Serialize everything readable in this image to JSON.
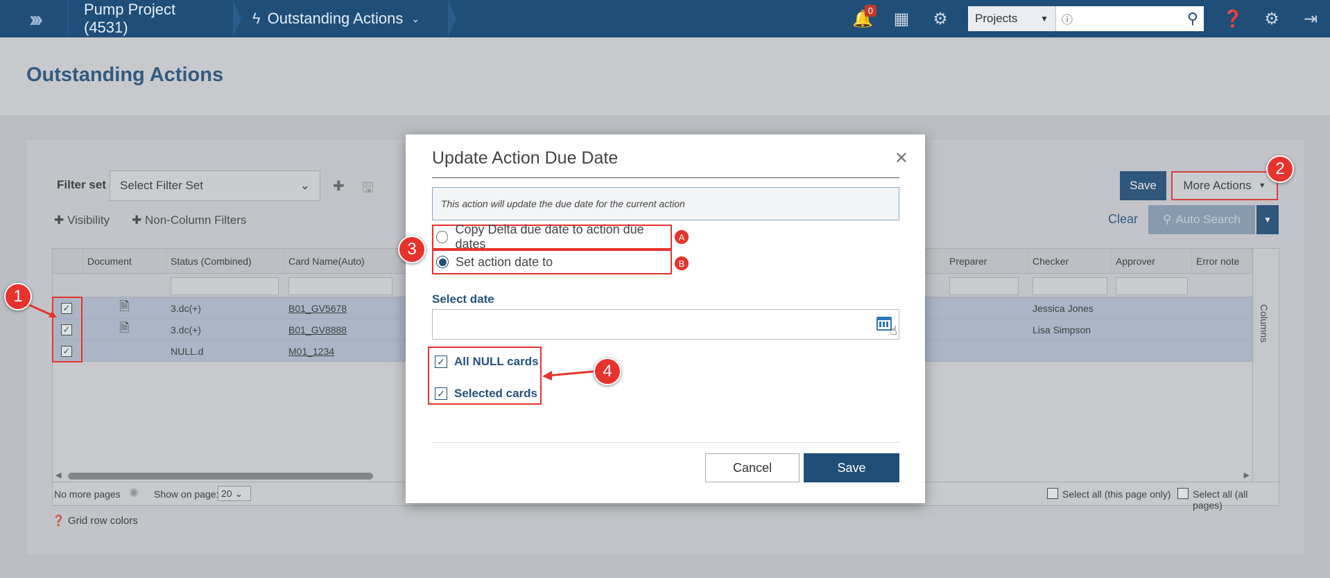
{
  "nav": {
    "project": "Pump Project (4531)",
    "section": "Outstanding Actions",
    "notification_count": "0",
    "project_select": "Projects"
  },
  "page": {
    "title": "Outstanding Actions"
  },
  "toolbar": {
    "filter_label": "Filter set",
    "filter_placeholder": "Select Filter Set",
    "visibility": "Visibility",
    "non_column_filters": "Non-Column Filters",
    "save": "Save",
    "more_actions": "More Actions",
    "clear": "Clear",
    "auto_search": "Auto Search"
  },
  "grid": {
    "headers": [
      "Document",
      "Status (Combined)",
      "Card Name(Auto)",
      "Preparer",
      "Checker",
      "Approver",
      "Error note"
    ],
    "rows": [
      {
        "status": "3.dc(+)",
        "card": "B01_GV5678",
        "checker": "Jessica Jones"
      },
      {
        "status": "3.dc(+)",
        "card": "B01_GV8888",
        "checker": "Lisa Simpson"
      },
      {
        "status": "NULL.d",
        "card": "M01_1234",
        "checker": ""
      }
    ],
    "columns_label": "Columns",
    "footer": {
      "no_more_pages": "No more pages",
      "show_on_page": "Show on page:",
      "page_size": "20",
      "select_all_page": "Select all (this page only)",
      "select_all_pages": "Select all (all pages)"
    },
    "row_colors": "Grid row colors"
  },
  "modal": {
    "title": "Update Action Due Date",
    "info": "This action will update the due date for the current action",
    "option_a": "Copy Delta due date to action due dates",
    "option_b": "Set action date to",
    "select_date_label": "Select date",
    "checkbox_null": "All NULL cards",
    "checkbox_selected": "Selected cards",
    "cancel": "Cancel",
    "save": "Save"
  },
  "callouts": [
    "1",
    "2",
    "3",
    "4",
    "A",
    "B"
  ]
}
